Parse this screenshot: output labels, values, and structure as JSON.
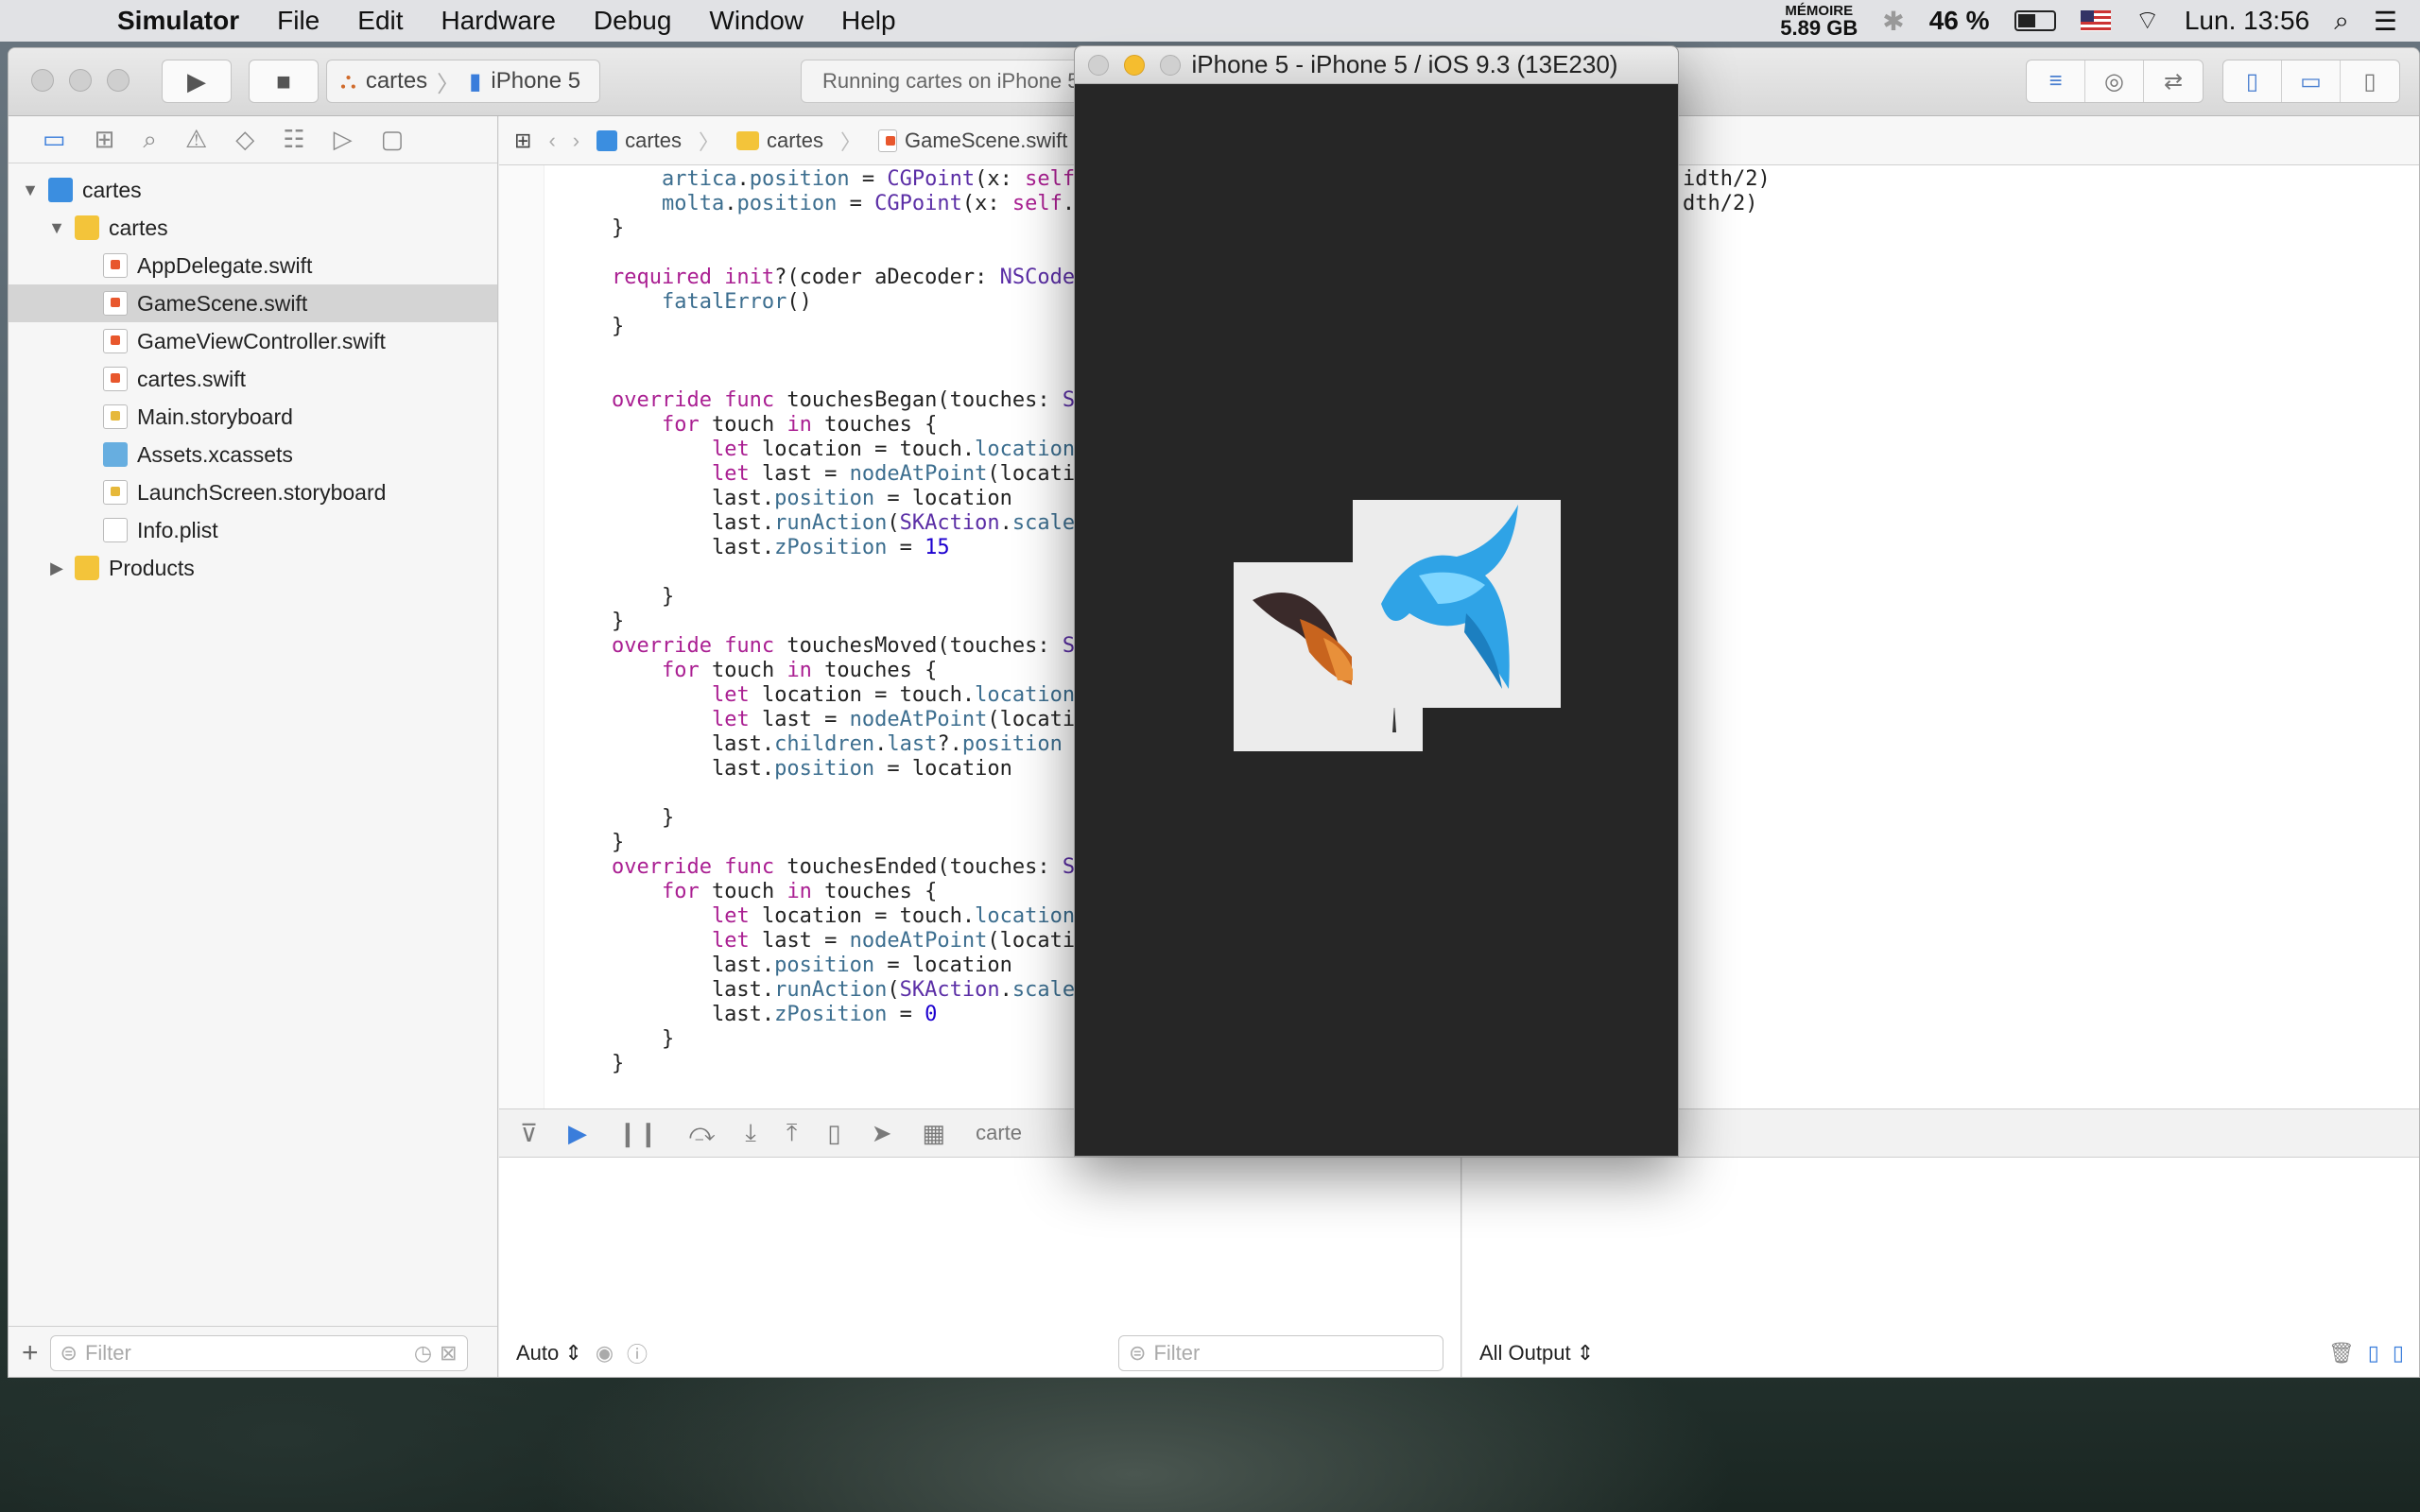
{
  "menubar": {
    "app_name": "Simulator",
    "items": [
      "File",
      "Edit",
      "Hardware",
      "Debug",
      "Window",
      "Help"
    ],
    "memory_label": "MÉMOIRE",
    "memory_value": "5.89 GB",
    "battery": "46 %",
    "clock": "Lun. 13:56"
  },
  "xcode": {
    "scheme_project": "cartes",
    "scheme_device": "iPhone 5",
    "status": "Running cartes on iPhone 5"
  },
  "navigator": {
    "project": "cartes",
    "group": "cartes",
    "files": [
      "AppDelegate.swift",
      "GameScene.swift",
      "GameViewController.swift",
      "cartes.swift",
      "Main.storyboard",
      "Assets.xcassets",
      "LaunchScreen.storyboard",
      "Info.plist"
    ],
    "selected": "GameScene.swift",
    "products": "Products",
    "filter_placeholder": "Filter"
  },
  "jumpbar": {
    "crumbs": [
      "cartes",
      "cartes",
      "GameScene.swift"
    ]
  },
  "code": {
    "right_lines": [
      "idth/2)",
      "dth/2)"
    ]
  },
  "debug": {
    "crumb": "carte"
  },
  "console": {
    "auto_label": "Auto",
    "filter_placeholder": "Filter",
    "output_label": "All Output"
  },
  "simulator": {
    "title": "iPhone 5 - iPhone 5 / iOS 9.3 (13E230)"
  }
}
